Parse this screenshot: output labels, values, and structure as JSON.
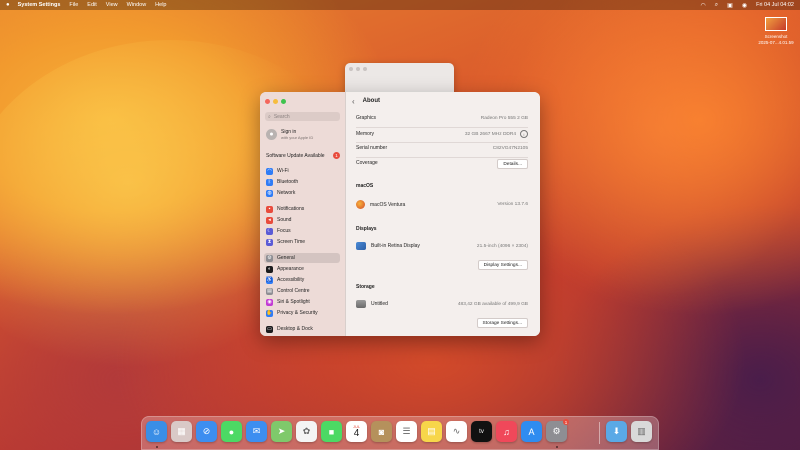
{
  "menubar": {
    "app": "System Settings",
    "items": [
      "File",
      "Edit",
      "View",
      "Window",
      "Help"
    ],
    "clock": "Fri 04 Jul  04:02"
  },
  "desktop": {
    "screenshot_label_1": "Screenshot",
    "screenshot_label_2": "2025-07...4.01.59"
  },
  "sidebar": {
    "search_placeholder": "Search",
    "sign_in": "Sign in",
    "sign_in_sub": "with your Apple ID",
    "update": "Software Update Available",
    "update_badge": "1",
    "items": [
      {
        "label": "Wi-Fi",
        "color": "#2f7cf6",
        "icon": "wifi-icon",
        "glyph": "◠"
      },
      {
        "label": "Bluetooth",
        "color": "#2f7cf6",
        "icon": "bluetooth-icon",
        "glyph": "ᛒ"
      },
      {
        "label": "Network",
        "color": "#2f7cf6",
        "icon": "globe-icon",
        "glyph": "◍"
      },
      {
        "label": "Notifications",
        "color": "#e84b3c",
        "icon": "bell-icon",
        "glyph": "▪"
      },
      {
        "label": "Sound",
        "color": "#e84b3c",
        "icon": "speaker-icon",
        "glyph": "◂"
      },
      {
        "label": "Focus",
        "color": "#5b5bd6",
        "icon": "moon-icon",
        "glyph": "☾"
      },
      {
        "label": "Screen Time",
        "color": "#5b5bd6",
        "icon": "hourglass-icon",
        "glyph": "⧗"
      },
      {
        "label": "General",
        "color": "#8e8e93",
        "icon": "gear-icon",
        "glyph": "⚙"
      },
      {
        "label": "Appearance",
        "color": "#1c1c1e",
        "icon": "appearance-icon",
        "glyph": "◐"
      },
      {
        "label": "Accessibility",
        "color": "#2f7cf6",
        "icon": "accessibility-icon",
        "glyph": "♿"
      },
      {
        "label": "Control Centre",
        "color": "#8e8e93",
        "icon": "control-centre-icon",
        "glyph": "▤"
      },
      {
        "label": "Siri & Spotlight",
        "color": "#c23bd4",
        "icon": "siri-icon",
        "glyph": "◉"
      },
      {
        "label": "Privacy & Security",
        "color": "#2f7cf6",
        "icon": "hand-icon",
        "glyph": "✋"
      },
      {
        "label": "Desktop & Dock",
        "color": "#1c1c1e",
        "icon": "dock-icon",
        "glyph": "▭"
      }
    ]
  },
  "about": {
    "title": "About",
    "graphics_label": "Graphics",
    "graphics_value": "Radeon Pro 555 2 GB",
    "memory_label": "Memory",
    "memory_value": "32 GB 2667 MHz DDR4",
    "serial_label": "Serial number",
    "serial_value": "C82VG47N2105",
    "coverage_label": "Coverage",
    "details_button": "Details...",
    "macos_section": "macOS",
    "macos_name": "macOS Ventura",
    "macos_version": "Version 13.7.6",
    "displays_section": "Displays",
    "display_name": "Built-in Retina Display",
    "display_value": "21.5-inch (4096 × 2304)",
    "display_settings_button": "Display Settings...",
    "storage_section": "Storage",
    "storage_name": "Untitled",
    "storage_value": "483,42 GB available of 499,9 GB",
    "storage_settings_button": "Storage Settings..."
  },
  "dock": {
    "calendar_month": "JUL",
    "calendar_day": "4",
    "appletv_label": "tv",
    "settings_badge": "1",
    "apps": [
      {
        "name": "finder-icon",
        "color": "#3a8ee6",
        "glyph": "☺"
      },
      {
        "name": "launchpad-icon",
        "color": "#d9c9c7",
        "glyph": "▦"
      },
      {
        "name": "safari-icon",
        "color": "#3d8ef0",
        "glyph": "⊘"
      },
      {
        "name": "messages-icon",
        "color": "#4cd964",
        "glyph": "●"
      },
      {
        "name": "mail-icon",
        "color": "#3d8ef0",
        "glyph": "✉"
      },
      {
        "name": "maps-icon",
        "color": "#7fc96b",
        "glyph": "➤"
      },
      {
        "name": "photos-icon",
        "color": "#f4f4f4",
        "glyph": "✿"
      },
      {
        "name": "facetime-icon",
        "color": "#4cd964",
        "glyph": "■"
      },
      {
        "name": "calendar-icon",
        "color": "#ffffff",
        "glyph": ""
      },
      {
        "name": "contacts-icon",
        "color": "#b5915c",
        "glyph": "◙"
      },
      {
        "name": "reminders-icon",
        "color": "#ffffff",
        "glyph": "☰"
      },
      {
        "name": "notes-icon",
        "color": "#f7d64a",
        "glyph": "▤"
      },
      {
        "name": "freeform-icon",
        "color": "#ffffff",
        "glyph": "∿"
      },
      {
        "name": "appletv-icon",
        "color": "#111111",
        "glyph": ""
      },
      {
        "name": "music-icon",
        "color": "#f0485a",
        "glyph": "♫"
      },
      {
        "name": "appstore-icon",
        "color": "#2f8cf0",
        "glyph": "A"
      },
      {
        "name": "system-settings-icon",
        "color": "#8e8e93",
        "glyph": "⚙"
      },
      {
        "name": "downloads-folder-icon",
        "color": "#5aa9e6",
        "glyph": "⬇"
      },
      {
        "name": "trash-icon",
        "color": "#d9d9d9",
        "glyph": "▥"
      }
    ]
  }
}
